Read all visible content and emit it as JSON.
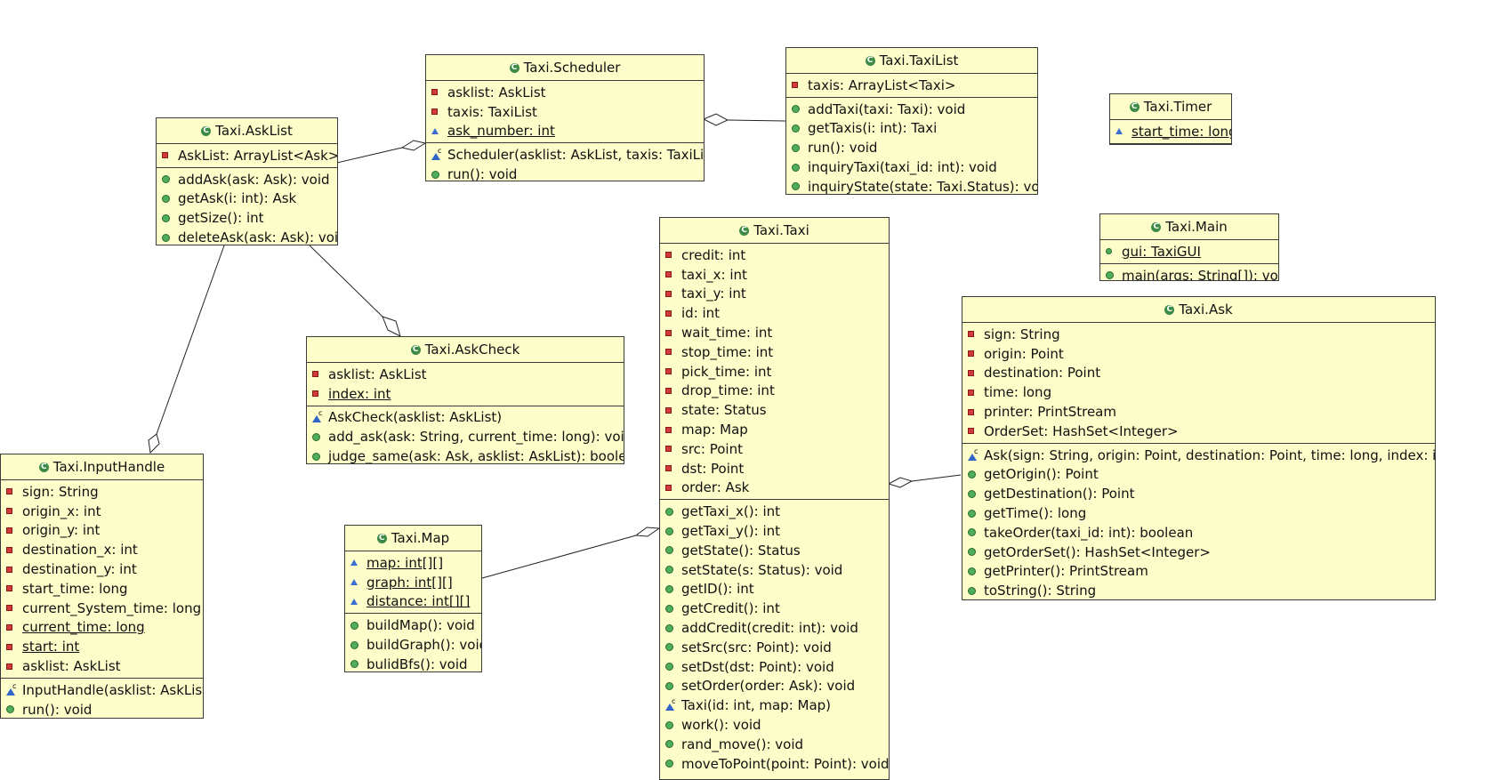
{
  "classes": {
    "scheduler": {
      "title": "Taxi.Scheduler",
      "fields": [
        {
          "vis": "private",
          "text": "asklist: AskList"
        },
        {
          "vis": "private",
          "text": "taxis: TaxiList"
        },
        {
          "vis": "package",
          "text": "ask_number: int",
          "static": true
        }
      ],
      "methods": [
        {
          "vis": "constructor",
          "text": "Scheduler(asklist: AskList, taxis: TaxiList)"
        },
        {
          "vis": "public",
          "text": "run(): void"
        }
      ]
    },
    "taxilist": {
      "title": "Taxi.TaxiList",
      "fields": [
        {
          "vis": "private",
          "text": "taxis: ArrayList<Taxi>"
        }
      ],
      "methods": [
        {
          "vis": "public",
          "text": "addTaxi(taxi: Taxi): void"
        },
        {
          "vis": "public",
          "text": "getTaxis(i: int): Taxi"
        },
        {
          "vis": "public",
          "text": "run(): void"
        },
        {
          "vis": "public",
          "text": "inquiryTaxi(taxi_id: int): void"
        },
        {
          "vis": "public",
          "text": "inquiryState(state: Taxi.Status): void"
        }
      ]
    },
    "timer": {
      "title": "Taxi.Timer",
      "fields": [
        {
          "vis": "package",
          "text": "start_time: long",
          "static": true
        }
      ],
      "methods": []
    },
    "asklist": {
      "title": "Taxi.AskList",
      "fields": [
        {
          "vis": "private",
          "text": "AskList: ArrayList<Ask>"
        }
      ],
      "methods": [
        {
          "vis": "public",
          "text": "addAsk(ask: Ask): void"
        },
        {
          "vis": "public",
          "text": "getAsk(i: int): Ask"
        },
        {
          "vis": "public",
          "text": "getSize(): int"
        },
        {
          "vis": "public",
          "text": "deleteAsk(ask: Ask): void"
        }
      ]
    },
    "main": {
      "title": "Taxi.Main",
      "fields": [
        {
          "vis": "public-static",
          "text": "gui: TaxiGUI",
          "static": true
        }
      ],
      "methods": [
        {
          "vis": "public",
          "text": "main(args: String[]): void",
          "static": true
        }
      ]
    },
    "taxi": {
      "title": "Taxi.Taxi",
      "fields": [
        {
          "vis": "private",
          "text": "credit: int"
        },
        {
          "vis": "private",
          "text": "taxi_x: int"
        },
        {
          "vis": "private",
          "text": "taxi_y: int"
        },
        {
          "vis": "private",
          "text": "id: int"
        },
        {
          "vis": "private",
          "text": "wait_time: int"
        },
        {
          "vis": "private",
          "text": "stop_time: int"
        },
        {
          "vis": "private",
          "text": "pick_time: int"
        },
        {
          "vis": "private",
          "text": "drop_time: int"
        },
        {
          "vis": "private",
          "text": "state: Status"
        },
        {
          "vis": "private",
          "text": "map: Map"
        },
        {
          "vis": "private",
          "text": "src: Point"
        },
        {
          "vis": "private",
          "text": "dst: Point"
        },
        {
          "vis": "private",
          "text": "order: Ask"
        }
      ],
      "methods": [
        {
          "vis": "public",
          "text": "getTaxi_x(): int"
        },
        {
          "vis": "public",
          "text": "getTaxi_y(): int"
        },
        {
          "vis": "public",
          "text": "getState(): Status"
        },
        {
          "vis": "public",
          "text": "setState(s: Status): void"
        },
        {
          "vis": "public",
          "text": "getID(): int"
        },
        {
          "vis": "public",
          "text": "getCredit(): int"
        },
        {
          "vis": "public",
          "text": "addCredit(credit: int): void"
        },
        {
          "vis": "public",
          "text": "setSrc(src: Point): void"
        },
        {
          "vis": "public",
          "text": "setDst(dst: Point): void"
        },
        {
          "vis": "public",
          "text": "setOrder(order: Ask): void"
        },
        {
          "vis": "constructor",
          "text": "Taxi(id: int, map: Map)"
        },
        {
          "vis": "public",
          "text": "work(): void"
        },
        {
          "vis": "public",
          "text": "rand_move(): void"
        },
        {
          "vis": "public",
          "text": "moveToPoint(point: Point): void"
        }
      ]
    },
    "ask": {
      "title": "Taxi.Ask",
      "fields": [
        {
          "vis": "private",
          "text": "sign: String"
        },
        {
          "vis": "private",
          "text": "origin: Point"
        },
        {
          "vis": "private",
          "text": "destination: Point"
        },
        {
          "vis": "private",
          "text": "time: long"
        },
        {
          "vis": "private",
          "text": "printer: PrintStream"
        },
        {
          "vis": "private",
          "text": "OrderSet: HashSet<Integer>"
        }
      ],
      "methods": [
        {
          "vis": "constructor",
          "text": "Ask(sign: String, origin: Point, destination: Point, time: long, index: int)"
        },
        {
          "vis": "public",
          "text": "getOrigin(): Point"
        },
        {
          "vis": "public",
          "text": "getDestination(): Point"
        },
        {
          "vis": "public",
          "text": "getTime(): long"
        },
        {
          "vis": "public",
          "text": "takeOrder(taxi_id: int): boolean"
        },
        {
          "vis": "public",
          "text": "getOrderSet(): HashSet<Integer>"
        },
        {
          "vis": "public",
          "text": "getPrinter(): PrintStream"
        },
        {
          "vis": "public",
          "text": "toString(): String"
        }
      ]
    },
    "askcheck": {
      "title": "Taxi.AskCheck",
      "fields": [
        {
          "vis": "private",
          "text": "asklist: AskList"
        },
        {
          "vis": "private",
          "text": "index: int",
          "static": true
        }
      ],
      "methods": [
        {
          "vis": "constructor",
          "text": "AskCheck(asklist: AskList)"
        },
        {
          "vis": "public",
          "text": "add_ask(ask: String, current_time: long): void"
        },
        {
          "vis": "public",
          "text": "judge_same(ask: Ask, asklist: AskList): boolean"
        }
      ]
    },
    "inputhandle": {
      "title": "Taxi.InputHandle",
      "fields": [
        {
          "vis": "private",
          "text": "sign: String"
        },
        {
          "vis": "private",
          "text": "origin_x: int"
        },
        {
          "vis": "private",
          "text": "origin_y: int"
        },
        {
          "vis": "private",
          "text": "destination_x: int"
        },
        {
          "vis": "private",
          "text": "destination_y: int"
        },
        {
          "vis": "private",
          "text": "start_time: long"
        },
        {
          "vis": "private",
          "text": "current_System_time: long"
        },
        {
          "vis": "private",
          "text": "current_time: long",
          "static": true
        },
        {
          "vis": "private",
          "text": "start: int",
          "static": true
        },
        {
          "vis": "private",
          "text": "asklist: AskList"
        }
      ],
      "methods": [
        {
          "vis": "constructor",
          "text": "InputHandle(asklist: AskList)"
        },
        {
          "vis": "public",
          "text": "run(): void"
        }
      ]
    },
    "map": {
      "title": "Taxi.Map",
      "fields": [
        {
          "vis": "package",
          "text": "map: int[][]",
          "static": true
        },
        {
          "vis": "package",
          "text": "graph: int[][]",
          "static": true
        },
        {
          "vis": "package",
          "text": "distance: int[][]",
          "static": true
        }
      ],
      "methods": [
        {
          "vis": "public",
          "text": "buildMap(): void"
        },
        {
          "vis": "public",
          "text": "buildGraph(): void"
        },
        {
          "vis": "public",
          "text": "bulidBfs(): void"
        }
      ]
    }
  }
}
